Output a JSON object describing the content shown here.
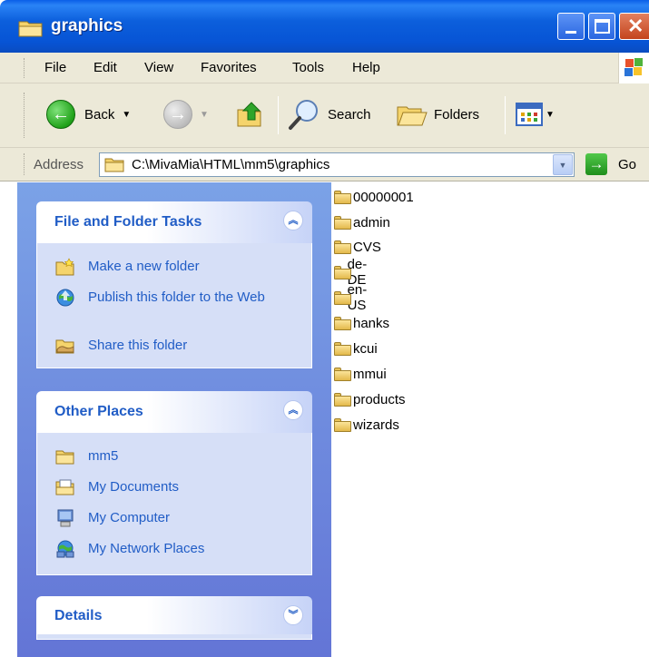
{
  "window": {
    "title": "graphics"
  },
  "menu": [
    "File",
    "Edit",
    "View",
    "Favorites",
    "Tools",
    "Help"
  ],
  "toolbar": {
    "back": "Back",
    "search": "Search",
    "folders": "Folders"
  },
  "address": {
    "label": "Address",
    "path": "C:\\MivaMia\\HTML\\mm5\\graphics",
    "go": "Go"
  },
  "taskpane": {
    "file_tasks": {
      "title": "File and Folder Tasks",
      "items": [
        {
          "label": "Make a new folder",
          "icon": "new-folder-icon"
        },
        {
          "label": "Publish this folder to the Web",
          "icon": "publish-web-icon"
        },
        {
          "label": "Share this folder",
          "icon": "share-folder-icon"
        }
      ]
    },
    "other_places": {
      "title": "Other Places",
      "items": [
        {
          "label": "mm5",
          "icon": "folder-icon"
        },
        {
          "label": "My Documents",
          "icon": "my-documents-icon"
        },
        {
          "label": "My Computer",
          "icon": "my-computer-icon"
        },
        {
          "label": "My Network Places",
          "icon": "network-places-icon"
        }
      ]
    },
    "details": {
      "title": "Details"
    }
  },
  "folders": [
    "00000001",
    "admin",
    "CVS",
    "de-DE",
    "en-US",
    "hanks",
    "kcui",
    "mmui",
    "products",
    "wizards"
  ],
  "colors": {
    "titlebar": "#0754d5",
    "task_link": "#215dc6",
    "pane_bg": "#7ba2e7",
    "panel_body": "#d6dff7"
  }
}
